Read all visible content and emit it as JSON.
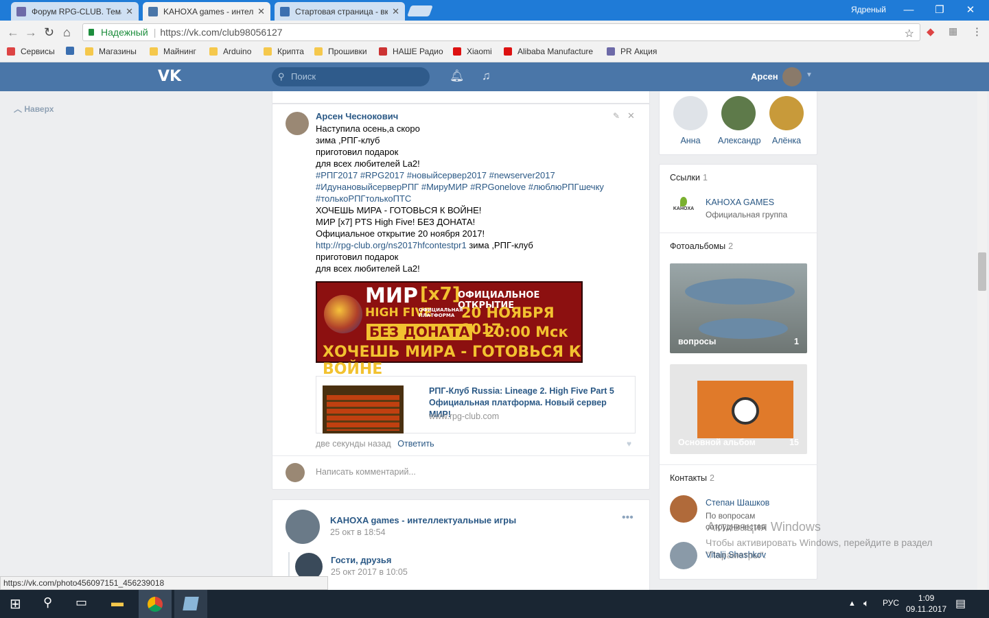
{
  "browser": {
    "tabs": [
      {
        "title": "Форум RPG-CLUB. Тема",
        "active": false
      },
      {
        "title": "KAHOXA games - интел",
        "active": true
      },
      {
        "title": "Стартовая страница - вк",
        "active": false
      }
    ],
    "profile_label": "Ядреный",
    "secure_label": "Надежный",
    "url": "https://vk.com/club98056127",
    "bookmarks": [
      "Сервисы",
      "Магазины",
      "Майнинг",
      "Arduino",
      "Крипта",
      "Прошивки",
      "НАШЕ Радио",
      "Xiaomi",
      "Alibaba Manufacture",
      "PR Акция"
    ],
    "status_url": "https://vk.com/photo456097151_456239018"
  },
  "vk": {
    "logo": "VK",
    "search_placeholder": "Поиск",
    "user_name": "Арсен",
    "up_button": "Наверх"
  },
  "post": {
    "author": "Арсен Чеснокович",
    "lines": [
      "Наступила осень,а скоро",
      "зима ,РПГ-клуб",
      "приготовил подарок",
      "для всех любителей La2!"
    ],
    "hashtags_1": "#РПГ2017 #RPG2017 #новыйсервер2017 #newserver2017",
    "hashtags_2": "#ИдунановыйсерверРПГ #МируМИР #RPGonelove #люблюРПГшечку",
    "hashtags_3": "#толькоРПГтолькоПТС",
    "lines_2": [
      "ХОЧЕШЬ МИРА - ГОТОВЬСЯ К ВОЙНЕ!",
      "МИР [x7] PTS High Five! БЕЗ ДОНАТА!",
      "Официальное открытие 20 ноября 2017!"
    ],
    "link_inline": "http://rpg-club.org/ns2017hfcontestpr1",
    "link_after": " зима ,РПГ-клуб",
    "lines_3": [
      "приготовил подарок",
      "для всех любителей La2!"
    ],
    "banner": {
      "mir": "МИР",
      "x7": "[x7]",
      "highfive": "HIGH FIVE",
      "platform": "ОФИЦИАЛЬНАЯ ПЛАТФОРМА",
      "official": "ОФИЦИАЛЬНОЕ ОТКРЫТИЕ",
      "date": "20 НОЯБРЯ 2017",
      "time": "20:00 Мск",
      "nodonate": "БЕЗ ДОНАТА",
      "slogan": "ХОЧЕШЬ МИРА - ГОТОВЬСЯ К ВОЙНЕ"
    },
    "link_card": {
      "title": "РПГ-Клуб Russia: Lineage 2. High Five Part 5 Официальная платформа. Новый сервер МИР!",
      "domain": "www.rpg-club.com"
    },
    "time": "две секунды назад",
    "reply": "Ответить",
    "comment_placeholder": "Написать комментарий..."
  },
  "post2": {
    "author": "KAHOXA games - интеллектуальные игры",
    "date": "25 окт в 18:54",
    "shared_author": "Гости, друзья",
    "shared_date": "25 окт 2017 в 10:05"
  },
  "sidebar": {
    "friends": [
      "Анна",
      "Александр",
      "Алёнка"
    ],
    "links_title": "Ссылки",
    "links_count": "1",
    "link_name": "KAHOXA GAMES",
    "link_desc": "Официальная группа",
    "albums_title": "Фотоальбомы",
    "albums_count": "2",
    "albums": [
      {
        "name": "вопросы",
        "count": "1"
      },
      {
        "name": "Основной альбом",
        "count": "15"
      }
    ],
    "contacts_title": "Контакты",
    "contacts_count": "2",
    "contacts": [
      {
        "name": "Степан Шашков",
        "role": "По вопросам сотрудничества"
      },
      {
        "name": "Vitalij Shashkov",
        "role": ""
      }
    ]
  },
  "watermark": {
    "line1": "Активация Windows",
    "line2": "Чтобы активировать Windows, перейдите в раздел",
    "line3": "\"Параметры\"."
  },
  "taskbar": {
    "lang": "РУС",
    "time": "1:09",
    "date": "09.11.2017"
  }
}
